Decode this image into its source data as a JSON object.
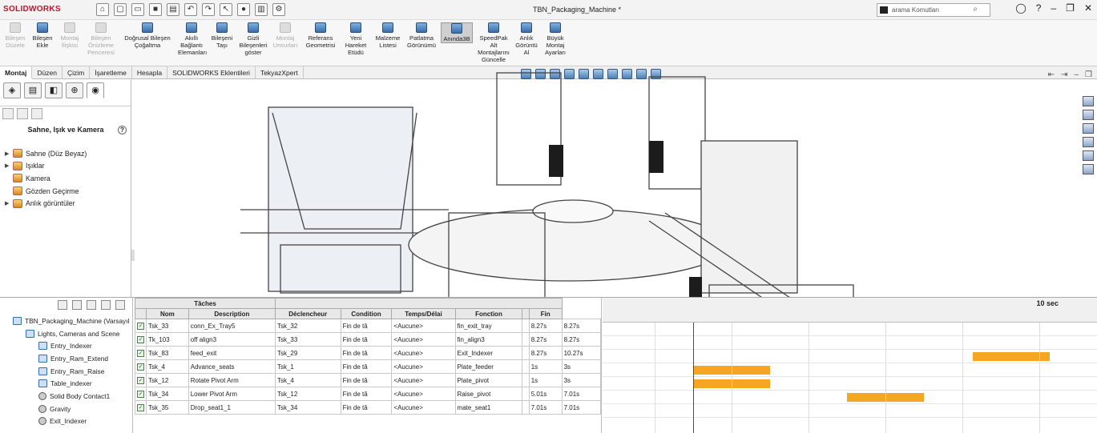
{
  "app": {
    "logo": "SOLIDWORKS",
    "document_title": "TBN_Packaging_Machine *"
  },
  "search": {
    "placeholder": "arama Komutları"
  },
  "ribbon": {
    "items": [
      {
        "label": "Bileşen Düzele",
        "disabled": true
      },
      {
        "label": "Bileşen Ekle",
        "disabled": false
      },
      {
        "label": "Montaj İlişkisi",
        "disabled": true
      },
      {
        "label": "Bileşen Önizleme Penceresi",
        "disabled": true
      },
      {
        "label": "Doğrusal Bileşen Çoğaltma",
        "disabled": false
      },
      {
        "label": "Akıllı Bağlantı Elemanları",
        "disabled": false
      },
      {
        "label": "Bileşeni Taşı",
        "disabled": false
      },
      {
        "label": "Gizli Bileşenleri göster",
        "disabled": false
      },
      {
        "label": "Montaj Unsurları",
        "disabled": true
      },
      {
        "label": "Referans Geometrisi",
        "disabled": false
      },
      {
        "label": "Yeni Hareket Etüdü",
        "disabled": false
      },
      {
        "label": "Malzeme Listesi",
        "disabled": false
      },
      {
        "label": "Patlatma Görünümü",
        "disabled": false
      },
      {
        "label": "Anında3B",
        "disabled": false,
        "active": true
      },
      {
        "label": "SpeedPak Alt Montajlarını Güncelle",
        "disabled": false
      },
      {
        "label": "Anlık Görüntü Al",
        "disabled": false
      },
      {
        "label": "Büyük Montaj Ayarları",
        "disabled": false
      }
    ]
  },
  "tabs": [
    "Montaj",
    "Düzen",
    "Çizim",
    "İşaretleme",
    "Hesapla",
    "SOLIDWORKS Eklentileri",
    "TekyazXpert"
  ],
  "left_panel": {
    "title": "Sahne, Işık ve Kamera",
    "help": "?",
    "items": [
      {
        "label": "Sahne (Düz Beyaz)",
        "expand": true
      },
      {
        "label": "Işıklar",
        "expand": true
      },
      {
        "label": "Kamera",
        "expand": false
      },
      {
        "label": "Gözden Geçirme",
        "expand": false
      },
      {
        "label": "Anlık görüntüler",
        "expand": true
      }
    ]
  },
  "motion_tree": {
    "items": [
      "TBN_Packaging_Machine (Varsayıl",
      "Lights, Cameras and Scene",
      "Entry_Indexer",
      "Entry_Ram_Extend",
      "Entry_Ram_Raise",
      "Table_indexer",
      "Solid Body Contact1",
      "Gravity",
      "Exit_Indexer"
    ]
  },
  "task_table": {
    "group_header": "Tâches",
    "headers": [
      "Nom",
      "Description",
      "Déclencheur",
      "Condition",
      "Temps/Délai",
      "Fonction",
      "",
      "Fin"
    ],
    "rows": [
      [
        "Tsk_33",
        "conn_Ex_Tray5",
        "Tsk_32",
        "Fin de tâ",
        "<Aucune>",
        "fin_exit_tray",
        "8.27s",
        "8.27s"
      ],
      [
        "Tk_103",
        "off align3",
        "Tsk_33",
        "Fin de tâ",
        "<Aucune>",
        "fin_align3",
        "8.27s",
        "8.27s"
      ],
      [
        "Tsk_83",
        "feed_exit",
        "Tsk_29",
        "Fin de tâ",
        "<Aucune>",
        "Exit_Indexer",
        "8.27s",
        "10.27s"
      ],
      [
        "Tsk_4",
        "Advance_seats",
        "Tsk_1",
        "Fin de tâ",
        "<Aucune>",
        "Plate_feeder",
        "1s",
        "3s"
      ],
      [
        "Tsk_12",
        "Rotate Pivot Arm",
        "Tsk_4",
        "Fin de tâ",
        "<Aucune>",
        "Plate_pivot",
        "1s",
        "3s"
      ],
      [
        "Tsk_34",
        "Lower Pivot Arm",
        "Tsk_12",
        "Fin de tâ",
        "<Aucune>",
        "Raise_pivot",
        "5.01s",
        "7.01s"
      ],
      [
        "Tsk_35",
        "Drop_seat1_1",
        "Tsk_34",
        "Fin de tâ",
        "<Aucune>",
        "mate_seat1",
        "7.01s",
        "7.01s"
      ]
    ]
  },
  "gantt": {
    "time_label": "10 sec",
    "bars": [
      {
        "start": 0,
        "end": 0
      },
      {
        "start": 0,
        "end": 0
      },
      {
        "start": 8.27,
        "end": 10.27
      },
      {
        "start": 1,
        "end": 3
      },
      {
        "start": 1,
        "end": 3
      },
      {
        "start": 5.01,
        "end": 7.01
      },
      {
        "start": 7.01,
        "end": 7.01
      }
    ],
    "accent": "#f5a623"
  }
}
